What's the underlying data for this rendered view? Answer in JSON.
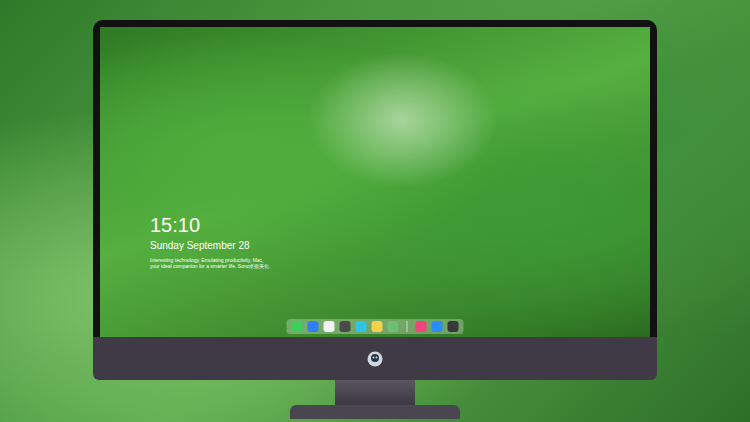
{
  "lock_screen": {
    "time": "15:10",
    "date": "Sunday September 28",
    "tagline": "Interesting technology, Emulating productivity, Mac, your ideal companion for a smarter life. Sono桌面美化"
  },
  "dock": {
    "items": [
      {
        "kind": "app",
        "color": "#3ecf5a"
      },
      {
        "kind": "app",
        "color": "#2f7ff0"
      },
      {
        "kind": "app",
        "color": "#f2f2f2"
      },
      {
        "kind": "app",
        "color": "#4a4a4a"
      },
      {
        "kind": "app",
        "color": "#2ec4e6"
      },
      {
        "kind": "app",
        "color": "#f5d24a"
      },
      {
        "kind": "app",
        "color": "#6fbf73"
      },
      {
        "kind": "separator",
        "color": "#ffffff"
      },
      {
        "kind": "app",
        "color": "#f0457a"
      },
      {
        "kind": "app",
        "color": "#2a8cf5"
      },
      {
        "kind": "app",
        "color": "#3a3a3a"
      }
    ]
  }
}
